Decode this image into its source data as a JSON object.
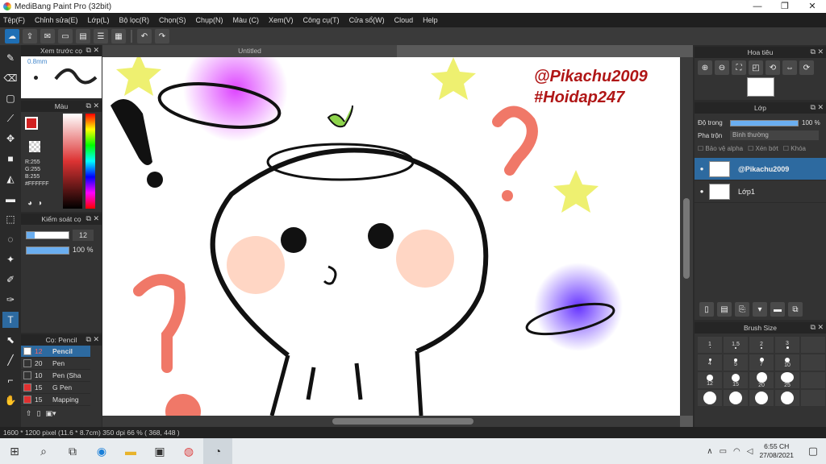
{
  "window": {
    "title": "MediBang Paint Pro (32bit)",
    "min": "—",
    "max": "❐",
    "close": "✕"
  },
  "menu": [
    "Tệp(F)",
    "Chỉnh sửa(E)",
    "Lớp(L)",
    "Bộ lọc(R)",
    "Chọn(S)",
    "Chụp(N)",
    "Màu (C)",
    "Xem(V)",
    "Công cụ(T)",
    "Cửa sổ(W)",
    "Cloud",
    "Help"
  ],
  "brush_preview": {
    "title": "Xem trước cọ",
    "size": "0.8mm"
  },
  "color_panel": {
    "title": "Màu",
    "r": "R:255",
    "g": "G:255",
    "b": "B:255",
    "hex": "#FFFFFF",
    "fg_color": "#d22222",
    "bg_color": "#ffffff"
  },
  "brush_control": {
    "title": "Kiểm soát cọ",
    "size_value": "12",
    "opacity_value": "100 %"
  },
  "brush_list": {
    "title": "Cọ: Pencil",
    "items": [
      {
        "size": "12",
        "name": "Pencil",
        "color": "#ffffff",
        "selected": true
      },
      {
        "size": "20",
        "name": "Pen",
        "color": "#333333",
        "selected": false
      },
      {
        "size": "10",
        "name": "Pen (Sha",
        "color": "#333333",
        "selected": false
      },
      {
        "size": "15",
        "name": "G Pen",
        "color": "#e03030",
        "selected": false
      },
      {
        "size": "15",
        "name": "Mapping",
        "color": "#e03030",
        "selected": false
      }
    ]
  },
  "document": {
    "tab": "Untitled",
    "watermark1": "@Pikachu2009",
    "watermark2": "#Hoidap247"
  },
  "navigator": {
    "title": "Hoa tiêu"
  },
  "layer_panel": {
    "title": "Lớp",
    "opacity_label": "Độ trong",
    "opacity_value": "100 %",
    "blend_label": "Pha trộn",
    "blend_value": "Bình thường",
    "protect_alpha": "Bảo vệ alpha",
    "clipping": "Xén bớt",
    "lock": "Khóa",
    "layers": [
      {
        "name": "@Pikachu2009",
        "selected": true
      },
      {
        "name": "Lớp1",
        "selected": false
      }
    ]
  },
  "brush_size": {
    "title": "Brush Size",
    "sizes": [
      "1",
      "1.5",
      "2",
      "3",
      "",
      "4",
      "5",
      "7",
      "10",
      "",
      "12",
      "15",
      "20",
      "25",
      "",
      "",
      "",
      "",
      "",
      ""
    ]
  },
  "status": {
    "text": "1600 * 1200 pixel   (11.6 * 8.7cm)   350 dpi   66 %   ( 368, 448 )"
  },
  "taskbar": {
    "time": "6:55 CH",
    "date": "27/08/2021"
  }
}
